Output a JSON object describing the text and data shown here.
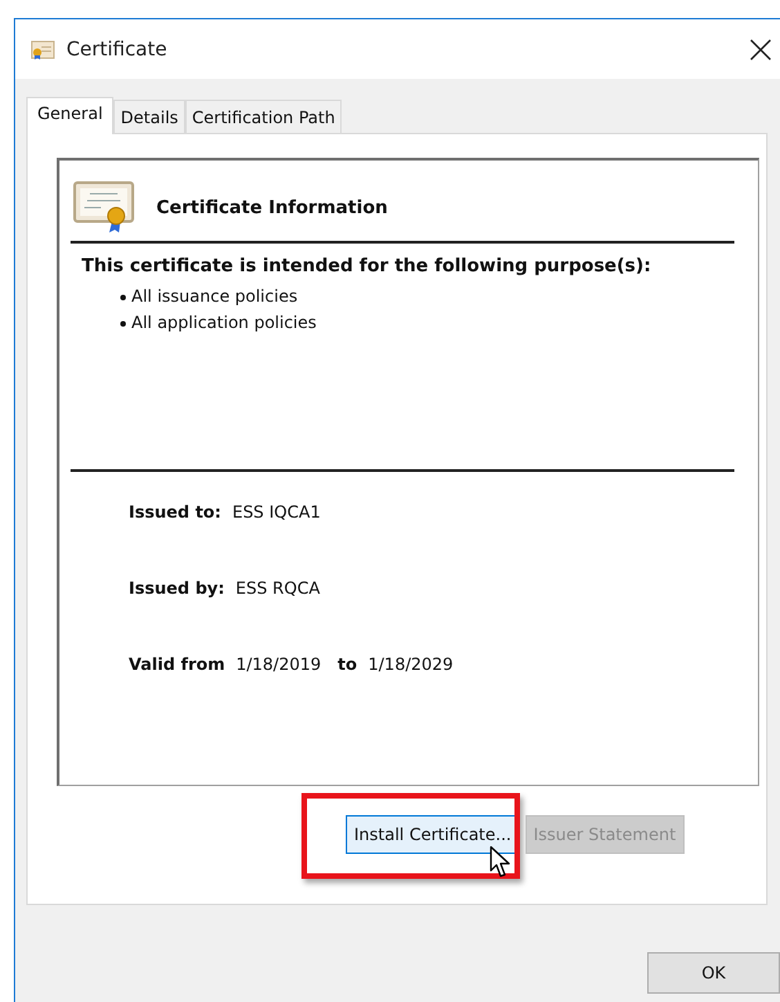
{
  "window": {
    "title": "Certificate"
  },
  "tabs": [
    {
      "label": "General",
      "selected": true
    },
    {
      "label": "Details",
      "selected": false
    },
    {
      "label": "Certification Path",
      "selected": false
    }
  ],
  "header": {
    "title": "Certificate Information"
  },
  "purpose": {
    "heading": "This certificate is intended for the following purpose(s):",
    "items": [
      "All issuance policies",
      "All application policies"
    ]
  },
  "fields": [
    {
      "kind": "pair",
      "label": "Issued to:",
      "value": "ESS IQCA1"
    },
    {
      "kind": "pair",
      "label": "Issued by:",
      "value": "ESS RQCA"
    },
    {
      "kind": "range",
      "label": "Valid from",
      "from": "1/18/2019",
      "joiner": "to",
      "to": "1/18/2029"
    }
  ],
  "buttons": [
    {
      "label": "Install Certificate...",
      "highlighted": true,
      "disabled": false
    },
    {
      "label": "Issuer Statement",
      "highlighted": false,
      "disabled": true
    }
  ],
  "footer_buttons": [
    {
      "label": "OK"
    }
  ]
}
